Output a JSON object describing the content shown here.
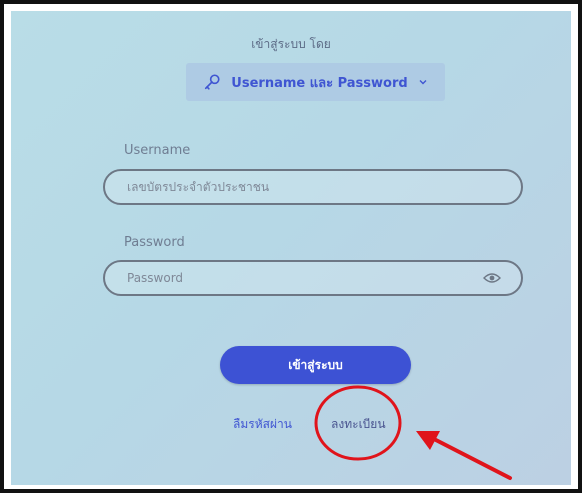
{
  "login": {
    "login_via_label": "เข้าสู่ระบบ โดย",
    "method_label": "Username และ Password",
    "username_label": "Username",
    "username_placeholder": "เลขบัตรประจำตัวประชาชน",
    "password_label": "Password",
    "password_placeholder": "Password",
    "submit_label": "เข้าสู่ระบบ",
    "forgot_password_label": "ลืมรหัสผ่าน",
    "register_label": "ลงทะเบียน"
  },
  "icons": {
    "method": "key-icon",
    "method_dropdown": "chevron-down-icon",
    "password_toggle": "eye-icon"
  },
  "colors": {
    "accent": "#3d52d4",
    "annotation": "#e0141b",
    "background": "#b9dde7"
  }
}
